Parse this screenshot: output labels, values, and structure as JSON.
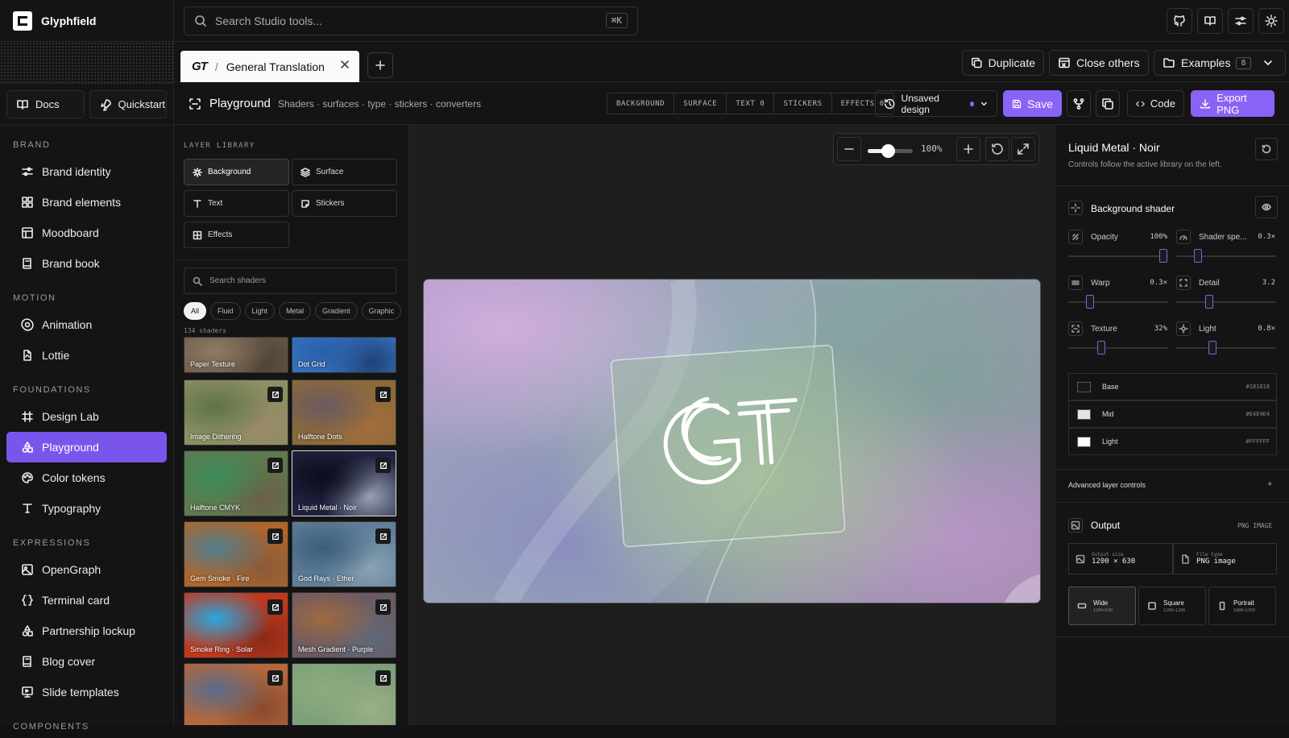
{
  "app": {
    "name": "Glyphfield"
  },
  "sidebar": {
    "buttons": [
      {
        "label": "Docs",
        "icon": "book-icon"
      },
      {
        "label": "Quickstart",
        "icon": "rocket-icon"
      }
    ],
    "sections": [
      {
        "title": "BRAND",
        "items": [
          {
            "label": "Brand identity",
            "icon": "sliders-icon"
          },
          {
            "label": "Brand elements",
            "icon": "grid-icon"
          },
          {
            "label": "Moodboard",
            "icon": "layout-icon"
          },
          {
            "label": "Brand book",
            "icon": "book-icon"
          }
        ]
      },
      {
        "title": "MOTION",
        "items": [
          {
            "label": "Animation",
            "icon": "orbit-icon"
          },
          {
            "label": "Lottie",
            "icon": "file-icon"
          }
        ]
      },
      {
        "title": "FOUNDATIONS",
        "items": [
          {
            "label": "Design Lab",
            "icon": "hash-icon"
          },
          {
            "label": "Playground",
            "icon": "shapes-icon",
            "active": true
          },
          {
            "label": "Color tokens",
            "icon": "palette-icon"
          },
          {
            "label": "Typography",
            "icon": "type-icon"
          }
        ]
      },
      {
        "title": "EXPRESSIONS",
        "items": [
          {
            "label": "OpenGraph",
            "icon": "image-icon"
          },
          {
            "label": "Terminal card",
            "icon": "braces-icon"
          },
          {
            "label": "Partnership lockup",
            "icon": "shapes-icon"
          },
          {
            "label": "Blog cover",
            "icon": "book-icon"
          },
          {
            "label": "Slide templates",
            "icon": "presentation-icon"
          }
        ]
      },
      {
        "title": "COMPONENTS",
        "items": []
      }
    ]
  },
  "topbar": {
    "search_placeholder": "Search Studio tools...",
    "shortcut": "⌘K"
  },
  "tabs": {
    "active": {
      "brand": "GT",
      "separator": "/",
      "label": "General Translation"
    },
    "actions": {
      "duplicate": "Duplicate",
      "close_others": "Close others",
      "examples": "Examples",
      "examples_count": "8"
    }
  },
  "toolbar": {
    "title": "Playground",
    "crumbs": "Shaders · surfaces · type · stickers · converters",
    "segments": [
      "BACKGROUND",
      "SURFACE",
      "TEXT 0",
      "STICKERS",
      "EFFECTS 0"
    ],
    "status": "Unsaved design",
    "save": "Save",
    "code": "Code",
    "export": "Export PNG"
  },
  "library": {
    "label": "LAYER LIBRARY",
    "layers": [
      "Background",
      "Surface",
      "Text",
      "Stickers",
      "Effects"
    ],
    "search_placeholder": "Search shaders",
    "filters": [
      "All",
      "Fluid",
      "Light",
      "Metal",
      "Gradient",
      "Graphic"
    ],
    "count": "134 shaders",
    "tiles": [
      {
        "label": "Paper Texture",
        "colors": [
          "#6b5a48",
          "#8e7a63",
          "#4d4237"
        ]
      },
      {
        "label": "Dot Grid",
        "colors": [
          "#3a79c9",
          "#2a5ea8",
          "#1d3e70"
        ]
      },
      {
        "label": "Image Dithering",
        "colors": [
          "#8b8f62",
          "#5f7349",
          "#9a8a6a"
        ]
      },
      {
        "label": "Halftone Dots",
        "colors": [
          "#8b6a3a",
          "#6b5a5f",
          "#a36d3d"
        ]
      },
      {
        "label": "Halftone CMYK",
        "colors": [
          "#5e7a4e",
          "#3d8b5a",
          "#6b5f46"
        ]
      },
      {
        "label": "Liquid Metal · Noir",
        "colors": [
          "#1f2340",
          "#0b0d1a",
          "#9aa0b6"
        ]
      },
      {
        "label": "Gem Smoke · Fire",
        "colors": [
          "#b0662b",
          "#4f7d8d",
          "#8a5a3a"
        ]
      },
      {
        "label": "God Rays · Ether",
        "colors": [
          "#5f7f9a",
          "#3e5d7a",
          "#8aa3b3"
        ]
      },
      {
        "label": "Smoke Ring · Solar",
        "colors": [
          "#c0391d",
          "#2aa7de",
          "#8b2a18"
        ]
      },
      {
        "label": "Mesh Gradient · Purple",
        "colors": [
          "#6a5a63",
          "#a0693f",
          "#5e6a7a"
        ]
      },
      {
        "label": "",
        "colors": [
          "#b4683b",
          "#5a6b8a",
          "#8a4a2d"
        ]
      },
      {
        "label": "",
        "colors": [
          "#7da07a",
          "#8fab7e",
          "#9bb085"
        ]
      }
    ]
  },
  "canvas": {
    "zoom_label": "100%",
    "zoom_level": 0.45,
    "logo_text": "GT"
  },
  "inspector": {
    "title": "Liquid Metal · Noir",
    "subtitle": "Controls follow the active library on the left.",
    "section": "Background shader",
    "controls": [
      {
        "label": "Opacity",
        "value": "100%",
        "level": 0.95
      },
      {
        "label": "Shader spe...",
        "value": "0.3×",
        "level": 0.22
      },
      {
        "label": "Warp",
        "value": "0.3×",
        "level": 0.22
      },
      {
        "label": "Detail",
        "value": "3.2",
        "level": 0.33
      },
      {
        "label": "Texture",
        "value": "32%",
        "level": 0.33
      },
      {
        "label": "Light",
        "value": "0.8×",
        "level": 0.36
      }
    ],
    "colors": [
      {
        "name": "Base",
        "hex": "#181818"
      },
      {
        "name": "Mid",
        "hex": "#E4E4E4"
      },
      {
        "name": "Light",
        "hex": "#FFFFFF"
      }
    ],
    "advanced": "Advanced layer controls",
    "advanced_toggle": "+",
    "output": {
      "title": "Output",
      "tag": "PNG IMAGE",
      "size_label": "Output size",
      "size_value": "1200 × 630",
      "type_label": "File type",
      "type_value": "PNG image",
      "formats": [
        {
          "name": "Wide",
          "dims": "1200×630"
        },
        {
          "name": "Square",
          "dims": "1200×1200"
        },
        {
          "name": "Portrait",
          "dims": "1080×1350"
        }
      ]
    }
  },
  "accent": "#8a62f5"
}
